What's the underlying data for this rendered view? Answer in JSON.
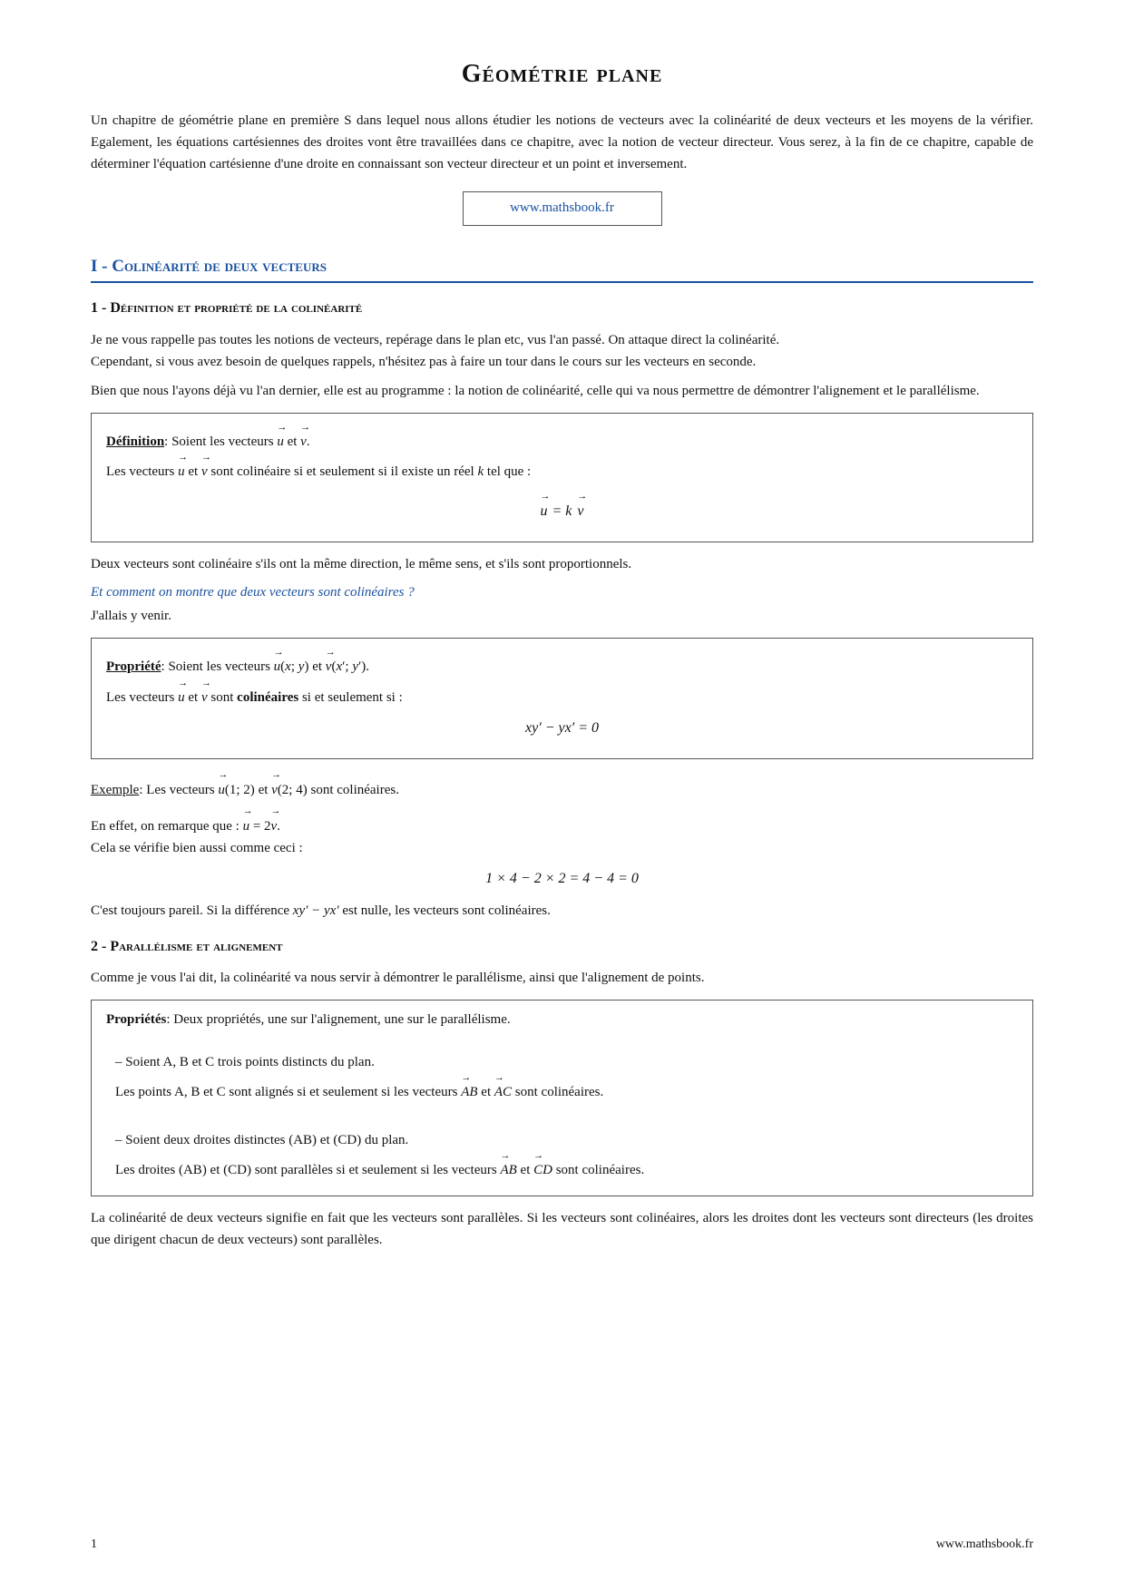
{
  "page": {
    "title": "Géométrie plane",
    "website": "www.mathsbook.fr",
    "footer_page": "1",
    "footer_website": "www.mathsbook.fr",
    "intro": "Un chapitre de géométrie plane en première S dans lequel nous allons étudier les notions de vecteurs avec la colinéarité de deux vecteurs et les moyens de la vérifier. Egalement, les équations cartésiennes des droites vont être travaillées dans ce chapitre, avec la notion de vecteur directeur. Vous serez, à la fin de ce chapitre, capable de déterminer l'équation cartésienne d'une droite en connaissant son vecteur directeur et un point et inversement.",
    "section_I_title": "I - Colinéarité de deux vecteurs",
    "subsection_1_title": "1 - Définition et propriété de la colinéarité",
    "subsection_1_para1": "Je ne vous rappelle pas toutes les notions de vecteurs, repérage dans le plan etc, vus l'an passé. On attaque direct la colinéarité.",
    "subsection_1_para2": "Cependant, si vous avez besoin de quelques rappels, n'hésitez pas à faire un tour dans le cours sur les vecteurs en seconde.",
    "subsection_1_para3": "Bien que nous l'ayons déjà vu l'an dernier, elle est au programme : la notion de colinéarité, celle qui va nous permettre de démontrer l'alignement et le parallélisme.",
    "def_box_label": "Définition",
    "def_box_text1": ": Soient les vecteurs",
    "def_box_text2": "et",
    "def_box_text3": ".",
    "def_box_text4": "Les vecteurs",
    "def_box_text5": "et",
    "def_box_text6": "sont colinéaire si et seulement si il existe un réel",
    "def_box_k": "k",
    "def_box_text7": "tel que :",
    "def_formula": "u⃗ = k v⃗",
    "para_colineaire": "Deux vecteurs sont colinéaire s'ils ont la même direction, le même sens, et s'ils sont proportionnels.",
    "italic_question": "Et comment on montre que deux vecteurs sont colinéaires ?",
    "italic_answer": "J'allais y venir.",
    "prop_box_label": "Propriété",
    "prop_box_text1": ": Soient les vecteurs",
    "prop_box_text2": "et",
    "prop_box_text3": ".",
    "prop_box_text4": "Les vecteurs",
    "prop_box_text5": "et",
    "prop_box_text6": "sont",
    "prop_box_bold": "colinéaires",
    "prop_box_text7": "si et seulement si :",
    "prop_formula": "xy′ − yx′ = 0",
    "example_label": "Exemple",
    "example_text": ": Les vecteurs",
    "example_u": "u⃗(1; 2)",
    "example_and": "et",
    "example_v": "v⃗(2; 4)",
    "example_end": "sont colinéaires.",
    "example_remark": "En effet, on remarque que :",
    "example_formula1": "u⃗ = 2 v⃗",
    "example_remark2": "Cela se vérifie bien aussi comme ceci :",
    "example_formula2": "1 × 4 − 2 × 2 = 4 − 4 = 0",
    "para_difference": "C'est toujours pareil. Si la différence",
    "para_difference2": "xy′ − yx′",
    "para_difference3": "est nulle, les vecteurs sont colinéaires.",
    "subsection_2_title": "2 - Parallélisme et alignement",
    "subsection_2_para": "Comme je vous l'ai dit, la colinéarité va nous servir à démontrer le parallélisme, ainsi que l'alignement de points.",
    "props2_label": "Propriétés",
    "props2_intro": ": Deux propriétés, une sur l'alignement, une sur le parallélisme.",
    "props2_item1_line1": "– Soient A, B et C trois points distincts du plan.",
    "props2_item1_line2": "Les points A, B et C sont alignés si et seulement si les vecteurs",
    "props2_item1_vec1": "AB",
    "props2_item1_and": "et",
    "props2_item1_vec2": "AC",
    "props2_item1_end": "sont colinéaires.",
    "props2_item2_line1": "– Soient deux droites distinctes (AB) et (CD) du plan.",
    "props2_item2_line2": "Les droites (AB) et (CD) sont parallèles si et seulement si les vecteurs",
    "props2_item2_vec1": "AB",
    "props2_item2_and": "et",
    "props2_item2_vec2": "CD",
    "props2_item2_end": "sont colinéaires.",
    "final_para": "La colinéarité de deux vecteurs signifie en fait que les vecteurs sont parallèles. Si les vecteurs sont colinéaires, alors les droites dont les vecteurs sont directeurs (les droites que dirigent chacun de deux vecteurs) sont parallèles."
  }
}
